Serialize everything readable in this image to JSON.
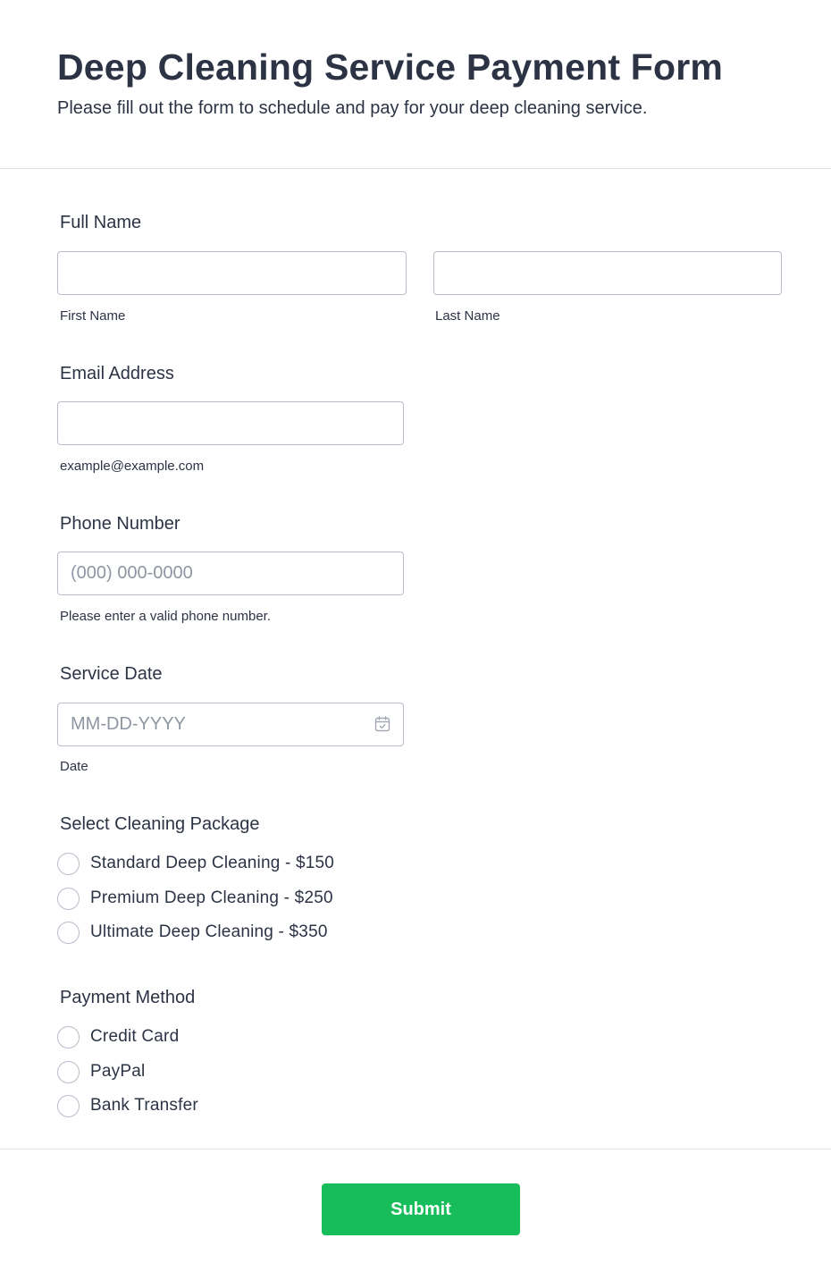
{
  "header": {
    "title": "Deep Cleaning Service Payment Form",
    "subtitle": "Please fill out the form to schedule and pay for your deep cleaning service."
  },
  "full_name": {
    "label": "Full Name",
    "first": {
      "value": "",
      "sublabel": "First Name"
    },
    "last": {
      "value": "",
      "sublabel": "Last Name"
    }
  },
  "email": {
    "label": "Email Address",
    "value": "",
    "sublabel": "example@example.com"
  },
  "phone": {
    "label": "Phone Number",
    "value": "",
    "placeholder": "(000) 000-0000",
    "sublabel": "Please enter a valid phone number."
  },
  "service_date": {
    "label": "Service Date",
    "value": "",
    "placeholder": "MM-DD-YYYY",
    "sublabel": "Date",
    "icon": "calendar-icon"
  },
  "package": {
    "label": "Select Cleaning Package",
    "options": [
      {
        "label": "Standard Deep Cleaning - $150",
        "selected": false
      },
      {
        "label": "Premium Deep Cleaning - $250",
        "selected": false
      },
      {
        "label": "Ultimate Deep Cleaning - $350",
        "selected": false
      }
    ]
  },
  "payment": {
    "label": "Payment Method",
    "options": [
      {
        "label": "Credit Card",
        "selected": false
      },
      {
        "label": "PayPal",
        "selected": false
      },
      {
        "label": "Bank Transfer",
        "selected": false
      }
    ]
  },
  "submit": {
    "label": "Submit"
  },
  "colors": {
    "text": "#2c3345",
    "border": "#b8bdc9",
    "placeholder": "#8f96a3",
    "submit_bg": "#18bd5b",
    "submit_text": "#ffffff"
  }
}
